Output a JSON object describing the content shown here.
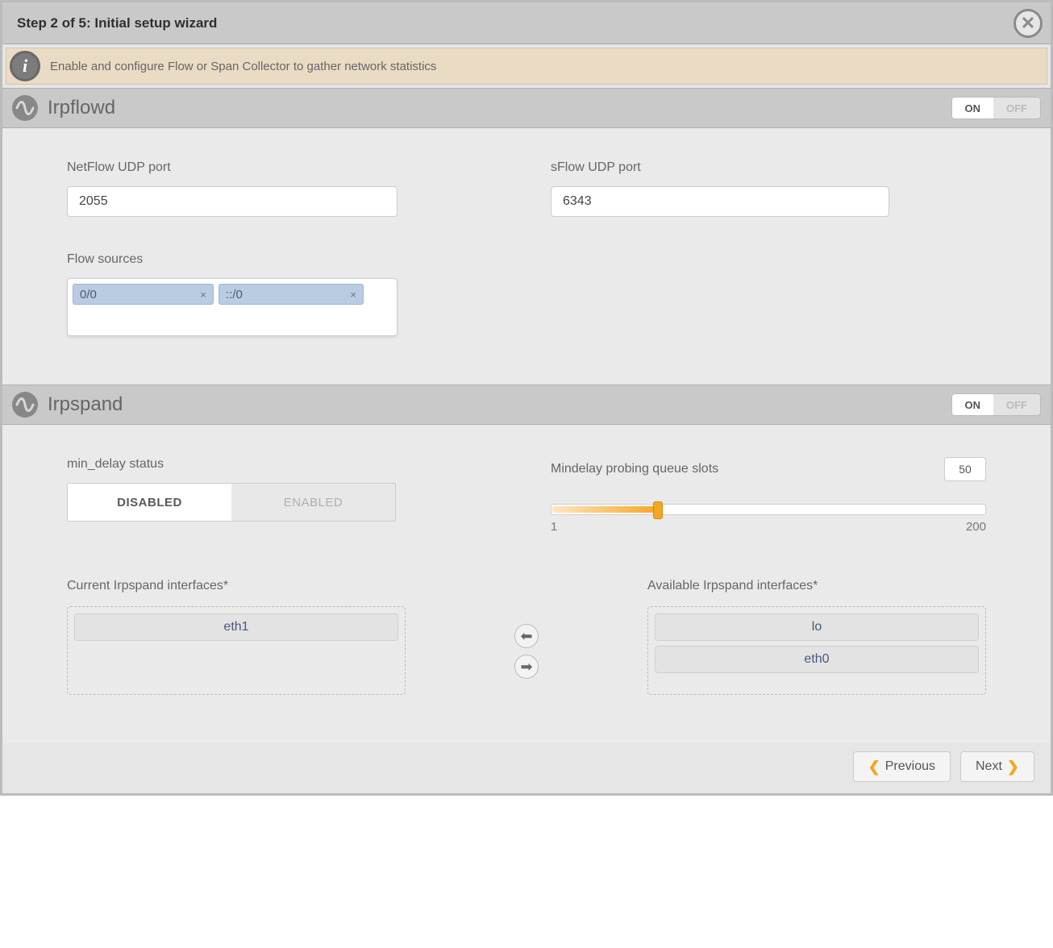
{
  "dialog": {
    "title": "Step 2 of 5: Initial setup wizard"
  },
  "banner": {
    "text": "Enable and configure Flow or Span Collector to gather network statistics"
  },
  "irpflowd": {
    "title": "Irpflowd",
    "toggle": {
      "on": "ON",
      "off": "OFF",
      "state": "on"
    },
    "netflow": {
      "label": "NetFlow UDP port",
      "value": "2055"
    },
    "sflow": {
      "label": "sFlow UDP port",
      "value": "6343"
    },
    "flow_sources": {
      "label": "Flow sources",
      "tags": [
        "0/0",
        "::/0"
      ]
    }
  },
  "irpspand": {
    "title": "Irpspand",
    "toggle": {
      "on": "ON",
      "off": "OFF",
      "state": "on"
    },
    "min_delay": {
      "label": "min_delay status",
      "disabled": "DISABLED",
      "enabled": "ENABLED",
      "state": "disabled"
    },
    "slider": {
      "label": "Mindelay probing queue slots",
      "value": "50",
      "min": "1",
      "max": "200",
      "min_num": 1,
      "max_num": 200,
      "value_num": 50
    },
    "current": {
      "label": "Current Irpspand interfaces*",
      "items": [
        "eth1"
      ]
    },
    "available": {
      "label": "Available Irpspand interfaces*",
      "items": [
        "lo",
        "eth0"
      ]
    }
  },
  "footer": {
    "previous": "Previous",
    "next": "Next"
  }
}
